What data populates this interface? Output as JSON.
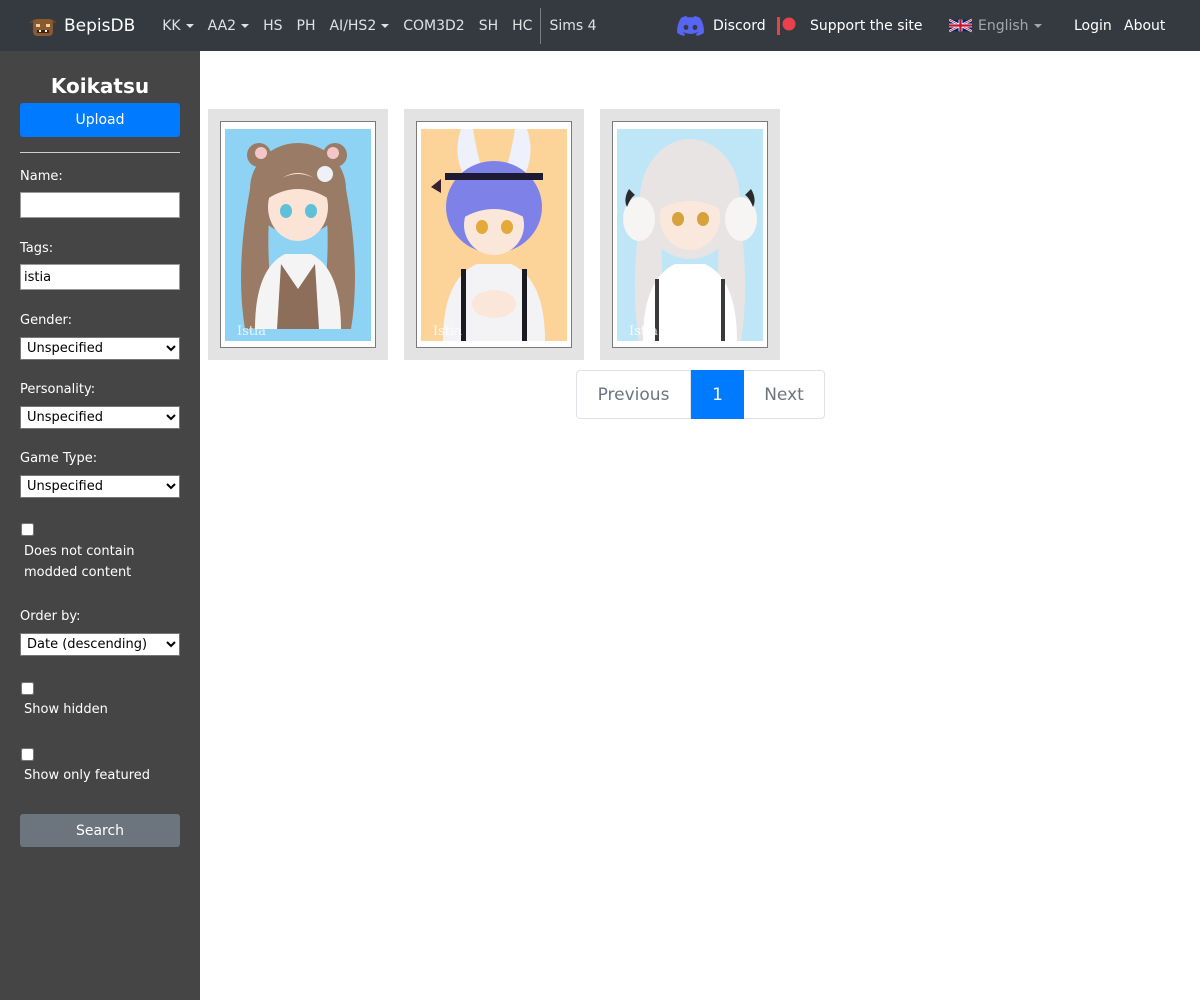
{
  "navbar": {
    "brand": "BepisDB",
    "game_links": [
      {
        "label": "KK",
        "dropdown": true
      },
      {
        "label": "AA2",
        "dropdown": true
      },
      {
        "label": "HS",
        "dropdown": false
      },
      {
        "label": "PH",
        "dropdown": false
      },
      {
        "label": "AI/HS2",
        "dropdown": true
      },
      {
        "label": "COM3D2",
        "dropdown": false
      },
      {
        "label": "SH",
        "dropdown": false
      },
      {
        "label": "HC",
        "dropdown": false
      }
    ],
    "sims4": "Sims 4",
    "discord": "Discord",
    "support": "Support the site",
    "language": "English",
    "login": "Login",
    "about": "About"
  },
  "sidebar": {
    "title": "Koikatsu",
    "upload_label": "Upload",
    "name_label": "Name:",
    "name_value": "",
    "tags_label": "Tags:",
    "tags_value": "istia",
    "gender_label": "Gender:",
    "gender_value": "Unspecified",
    "personality_label": "Personality:",
    "personality_value": "Unspecified",
    "game_type_label": "Game Type:",
    "game_type_value": "Unspecified",
    "no_modded_label": "Does not contain modded content",
    "order_label": "Order by:",
    "order_value": "Date (descending)",
    "show_hidden_label": "Show hidden",
    "featured_label": "Show only featured",
    "search_label": "Search"
  },
  "cards": [
    {
      "watermark": "Istia",
      "bg": "#8fd3f4"
    },
    {
      "watermark": "Istia",
      "bg": "#fcd49a"
    },
    {
      "watermark": "Istia",
      "bg": "#bfe6f7"
    }
  ],
  "pagination": {
    "previous": "Previous",
    "current": "1",
    "next": "Next"
  },
  "colors": {
    "navbar": "#343a40",
    "sidebar": "#454545",
    "primary": "#007bff",
    "secondary": "#6c757d",
    "support_red": "#e8414a",
    "discord": "#5865f2"
  }
}
